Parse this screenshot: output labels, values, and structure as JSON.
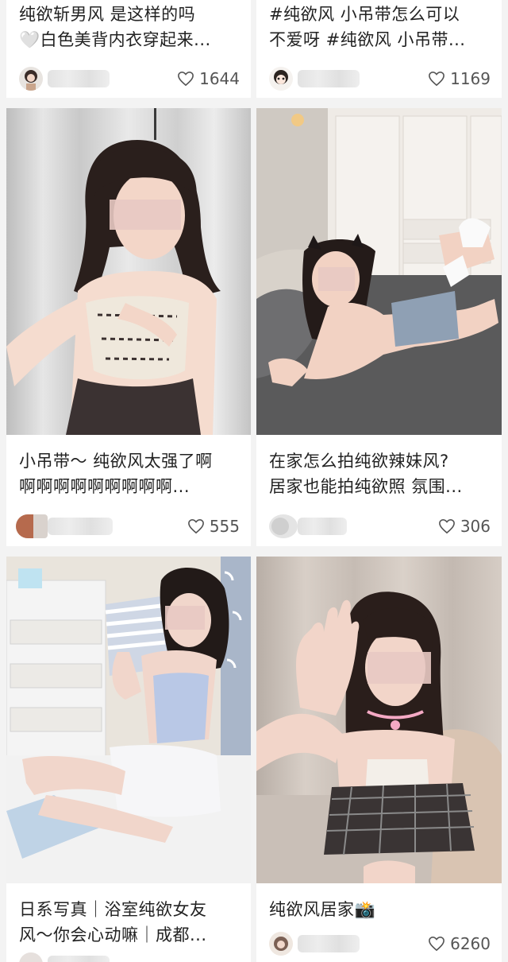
{
  "cards": [
    {
      "title": "纯欲斩男风 是这样的吗\n🤍白色美背内衣穿起来...",
      "likes": "1644"
    },
    {
      "title": "#纯欲风 小吊带怎么可以\n不爱呀 #纯欲风 小吊带...",
      "likes": "1169"
    },
    {
      "title": "小吊带～ 纯欲风太强了啊\n啊啊啊啊啊啊啊啊啊...",
      "likes": "555"
    },
    {
      "title": "在家怎么拍纯欲辣妹风?\n居家也能拍纯欲照 氛围...",
      "likes": "306"
    },
    {
      "title": "日系写真｜浴室纯欲女友\n风～你会心动嘛｜成都...",
      "likes": ""
    },
    {
      "title": "纯欲风居家📸",
      "likes": "6260"
    }
  ],
  "colors": {
    "background": "#f3f3f3",
    "card": "#ffffff",
    "title_text": "#222222",
    "likes_text": "#555555"
  },
  "icons": {
    "like": "heart-outline-icon",
    "avatar": "user-avatar"
  }
}
